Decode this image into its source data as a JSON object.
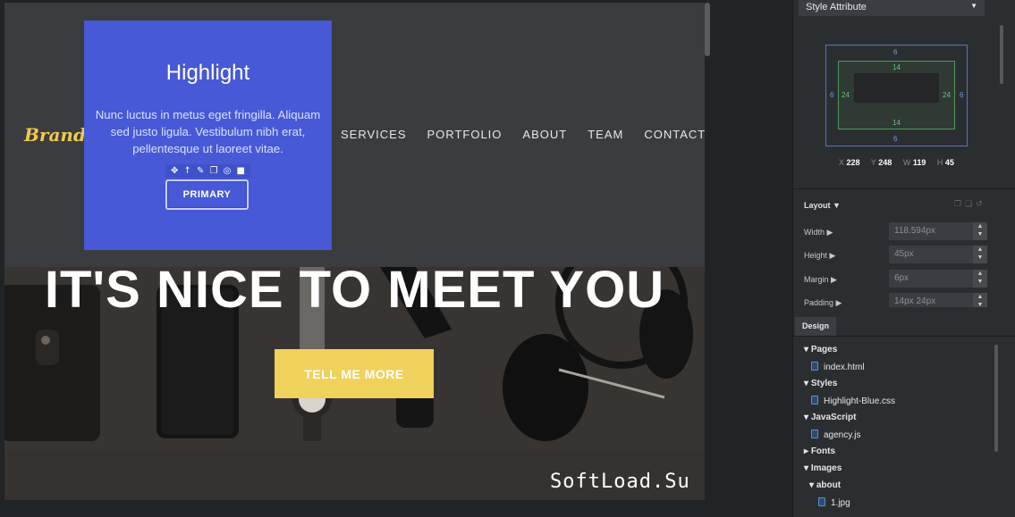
{
  "canvas": {
    "brand": "Brand",
    "nav_links": [
      "SERVICES",
      "PORTFOLIO",
      "ABOUT",
      "TEAM",
      "CONTACT"
    ],
    "highlight": {
      "title": "Highlight",
      "text": "Nunc luctus in metus eget fringilla. Aliquam sed justo ligula. Vestibulum nibh erat, pellentesque ut laoreet vitae.",
      "button_label": "PRIMARY",
      "toolbar_icons": [
        "move-icon",
        "arrow-up-icon",
        "pencil-icon",
        "copy-icon",
        "hide-icon",
        "trash-icon"
      ]
    },
    "hero": {
      "title": "IT'S NICE TO MEET YOU",
      "button_label": "TELL ME MORE"
    },
    "watermark": "SoftLoad.Su"
  },
  "panel": {
    "style_select": "Style Attribute",
    "box_model": {
      "margin_top": "6",
      "margin_bottom": "6",
      "margin_left": "6",
      "margin_right": "6",
      "padding_top": "14",
      "padding_bottom": "14",
      "padding_left": "24",
      "padding_right": "24"
    },
    "position": {
      "x_label": "X",
      "x": "228",
      "y_label": "Y",
      "y": "248",
      "w_label": "W",
      "w": "119",
      "h_label": "H",
      "h": "45"
    },
    "layout": {
      "title": "Layout",
      "props": [
        {
          "label": "Width",
          "value": "118.594px"
        },
        {
          "label": "Height",
          "value": "45px"
        },
        {
          "label": "Margin",
          "value": "6px"
        },
        {
          "label": "Padding",
          "value": "14px 24px"
        }
      ]
    },
    "design_tab": "Design",
    "tree": [
      {
        "label": "Pages",
        "kind": "folder"
      },
      {
        "label": "index.html",
        "kind": "file"
      },
      {
        "label": "Styles",
        "kind": "folder"
      },
      {
        "label": "Highlight-Blue.css",
        "kind": "file"
      },
      {
        "label": "JavaScript",
        "kind": "folder"
      },
      {
        "label": "agency.js",
        "kind": "file"
      },
      {
        "label": "Fonts",
        "kind": "folder-collapsed"
      },
      {
        "label": "Images",
        "kind": "folder"
      },
      {
        "label": "about",
        "kind": "subfolder"
      },
      {
        "label": "1.jpg",
        "kind": "subfile"
      }
    ]
  },
  "colors": {
    "accent_blue": "#4759d6",
    "hero_button": "#f0d15b",
    "brand": "#f2c94c"
  }
}
